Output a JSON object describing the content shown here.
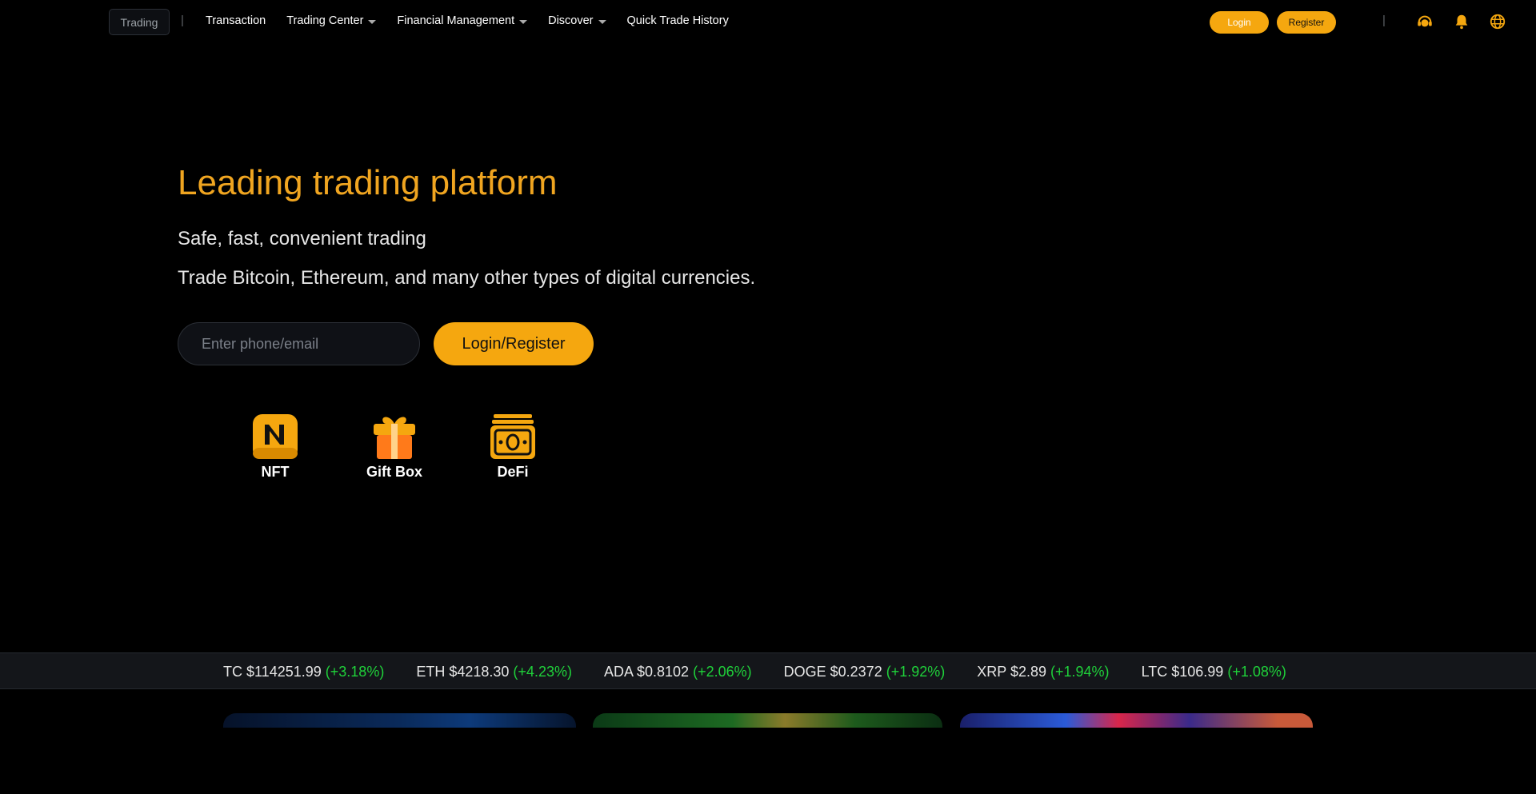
{
  "header": {
    "logo_label": "Trading",
    "separator": "|",
    "nav": [
      {
        "label": "Transaction",
        "dropdown": false
      },
      {
        "label": "Trading Center",
        "dropdown": true
      },
      {
        "label": "Financial Management",
        "dropdown": true
      },
      {
        "label": "Discover",
        "dropdown": true
      },
      {
        "label": "Quick Trade History",
        "dropdown": false
      }
    ],
    "login_label": "Login",
    "register_label": "Register",
    "icons": [
      "support-icon",
      "bell-icon",
      "globe-icon"
    ]
  },
  "hero": {
    "title": "Leading trading platform",
    "subtitle": "Safe, fast, convenient trading",
    "description": "Trade Bitcoin, Ethereum, and many other types of digital currencies.",
    "input_placeholder": "Enter phone/email",
    "cta_label": "Login/Register"
  },
  "features": [
    {
      "label": "NFT",
      "icon": "nft-icon"
    },
    {
      "label": "Gift Box",
      "icon": "gift-box-icon"
    },
    {
      "label": "DeFi",
      "icon": "defi-icon"
    }
  ],
  "ticker": [
    {
      "pair": "TC $114251.99",
      "change": "(+3.18%)"
    },
    {
      "pair": "ETH $4218.30",
      "change": "(+4.23%)"
    },
    {
      "pair": "ADA $0.8102",
      "change": "(+2.06%)"
    },
    {
      "pair": "DOGE $0.2372",
      "change": "(+1.92%)"
    },
    {
      "pair": "XRP $2.89",
      "change": "(+1.94%)"
    },
    {
      "pair": "LTC $106.99",
      "change": "(+1.08%)"
    }
  ],
  "colors": {
    "accent": "#f5a70f",
    "title": "#f0a520",
    "positive": "#1fd13a",
    "background": "#000000"
  }
}
